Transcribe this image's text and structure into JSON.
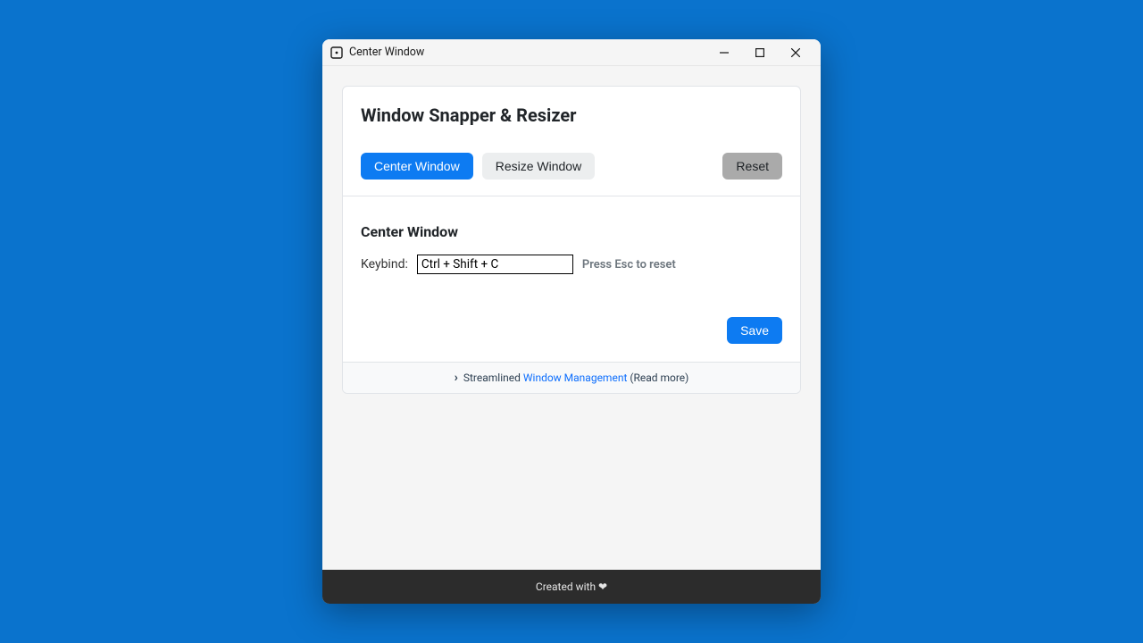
{
  "window": {
    "title": "Center Window"
  },
  "card": {
    "title": "Window Snapper & Resizer",
    "tabs": {
      "center": "Center Window",
      "resize": "Resize Window",
      "reset": "Reset"
    }
  },
  "panel": {
    "title": "Center Window",
    "keybind_label": "Keybind:",
    "keybind_value": "Ctrl + Shift + C",
    "hint": "Press Esc to reset",
    "save_label": "Save"
  },
  "footer": {
    "text_prefix": "Streamlined ",
    "link_text": "Window Management",
    "text_suffix": " (Read more)"
  },
  "bottombar": {
    "text": "Created with ❤"
  }
}
